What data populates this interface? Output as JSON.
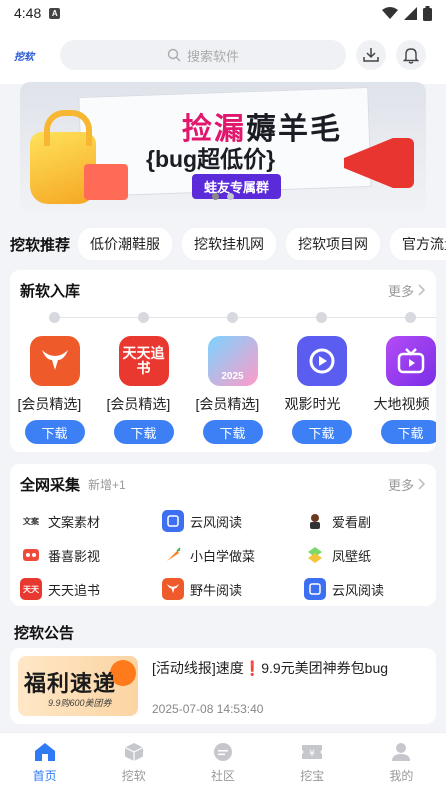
{
  "status": {
    "time": "4:48",
    "a_icon": "A"
  },
  "topbar": {
    "logo": "挖软",
    "search_placeholder": "搜索软件"
  },
  "banner": {
    "line1_a": "捡漏",
    "line1_b": "薅羊毛",
    "line2": "{bug超低价}",
    "tag": "蛙友专属群"
  },
  "recommend": {
    "lead": "挖软推荐",
    "chips": [
      "低价潮鞋服",
      "挖软挂机网",
      "挖软项目网",
      "官方流量卡"
    ]
  },
  "new_apps": {
    "title": "新软入库",
    "more": "更多",
    "download_label": "下载",
    "apps": [
      {
        "name": "[会员精选]",
        "icon": "bull-icon",
        "color": "#ef5a2a",
        "icon_text": ""
      },
      {
        "name": "[会员精选]",
        "icon": "tiantian-icon",
        "color": "#e8382f",
        "icon_text": "天天追书"
      },
      {
        "name": "[会员精选]",
        "icon": "app-2025-icon",
        "color": "#7bc8ff",
        "icon_text": "2025"
      },
      {
        "name": "观影时光",
        "icon": "video-play-icon",
        "color": "#5b5cf0",
        "icon_text": ""
      },
      {
        "name": "大地视频",
        "icon": "tv-icon",
        "color": "#9b3cf2",
        "icon_text": ""
      }
    ]
  },
  "collect": {
    "title": "全网采集",
    "subtitle": "新增+1",
    "more": "更多",
    "items": [
      {
        "name": "文案素材",
        "color": "#ffffff",
        "text": "文案"
      },
      {
        "name": "云风阅读",
        "color": "#3d6ff2",
        "text": ""
      },
      {
        "name": "爱看剧",
        "color": "#ffffff",
        "text": ""
      },
      {
        "name": "番喜影视",
        "color": "#f04a3a",
        "text": ""
      },
      {
        "name": "小白学做菜",
        "color": "#ffffff",
        "text": ""
      },
      {
        "name": "凤壁纸",
        "color": "#ffffff",
        "text": ""
      },
      {
        "name": "天天追书",
        "color": "#e8382f",
        "text": "天天"
      },
      {
        "name": "野牛阅读",
        "color": "#ef5a2a",
        "text": ""
      },
      {
        "name": "云风阅读",
        "color": "#3d6ff2",
        "text": ""
      }
    ]
  },
  "notice": {
    "title": "挖软公告",
    "thumb_title": "福利速递",
    "thumb_sub": "9.9购600美团券",
    "item_title": "[活动线报]速度❗9.9元美团神券包bug",
    "item_date": "2025-07-08 14:53:40"
  },
  "nav": [
    "首页",
    "挖软",
    "社区",
    "挖宝",
    "我的"
  ],
  "colors": {
    "accent": "#2f7bf5",
    "download": "#3d80f5"
  }
}
